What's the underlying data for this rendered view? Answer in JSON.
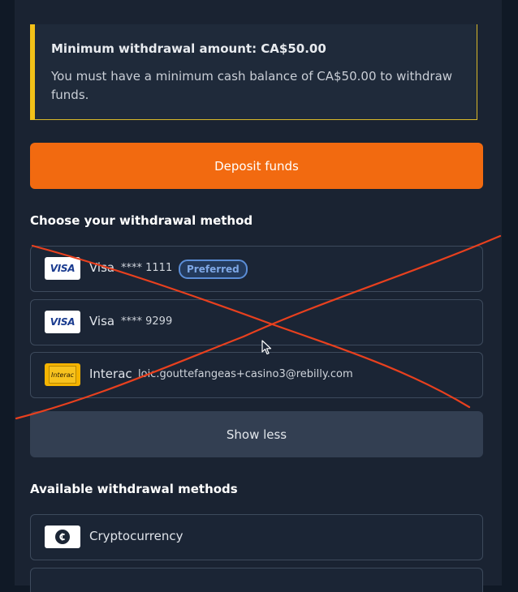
{
  "notice": {
    "title": "Minimum withdrawal amount: CA$50.00",
    "body": "You must have a minimum cash balance of CA$50.00 to withdraw funds."
  },
  "deposit_button": {
    "label": "Deposit funds"
  },
  "withdrawal_methods": {
    "title": "Choose your withdrawal method",
    "items": [
      {
        "logo": "visa-logo",
        "name": "Visa",
        "masked": "**** 1111",
        "badge": "Preferred"
      },
      {
        "logo": "visa-logo",
        "name": "Visa",
        "masked": "**** 9299"
      },
      {
        "logo": "interac-logo",
        "name": "Interac",
        "detail": "loic.gouttefangeas+casino3@rebilly.com"
      }
    ],
    "show_less_label": "Show less"
  },
  "available_methods": {
    "title": "Available withdrawal methods",
    "items": [
      {
        "logo": "crypto-icon",
        "name": "Cryptocurrency"
      }
    ]
  },
  "logos": {
    "visa_text": "VISA",
    "interac_text": "Interac"
  },
  "colors": {
    "accent_orange": "#f26a10",
    "notice_yellow": "#f2c018",
    "badge_blue": "#5b8dd6",
    "annotation_red": "#e8401e"
  }
}
